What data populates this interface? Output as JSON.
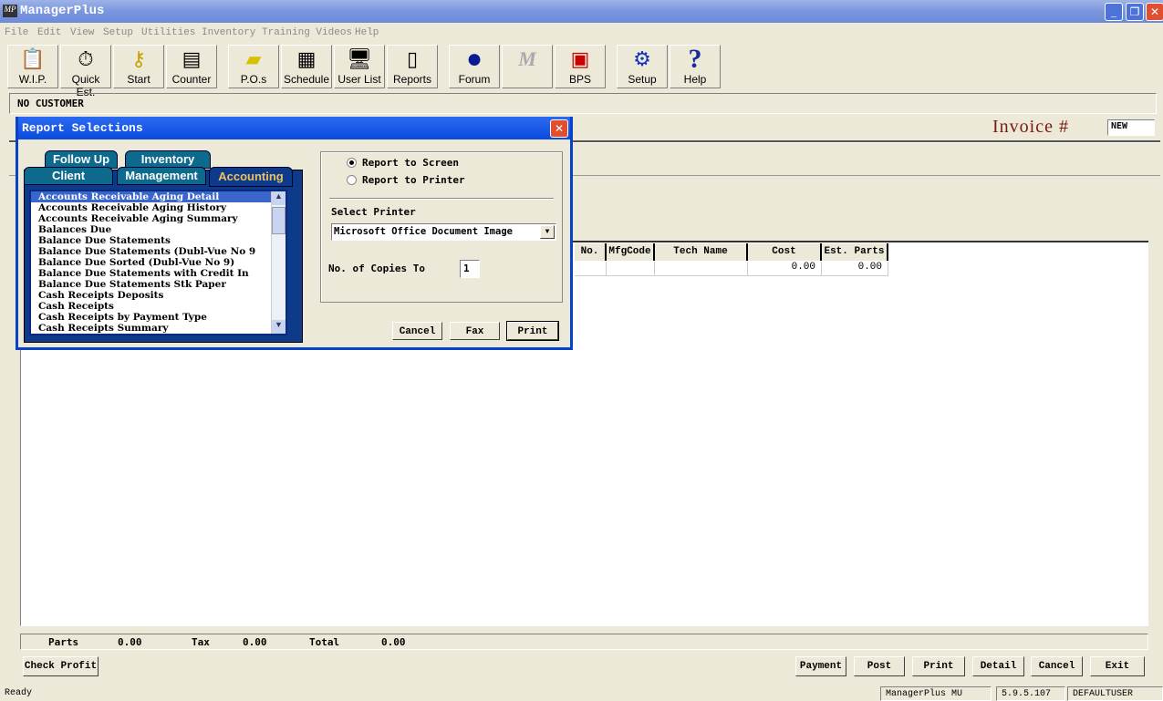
{
  "app": {
    "title": "ManagerPlus",
    "logo": "MP"
  },
  "menu": [
    "File",
    "Edit",
    "View",
    "Setup",
    "Utilities",
    "Inventory",
    "Training Videos",
    "Help"
  ],
  "toolbar": [
    {
      "label": "W.I.P.",
      "icon": "clipboard-icon"
    },
    {
      "label": "Quick Est.",
      "icon": "stopwatch-icon"
    },
    {
      "label": "Start",
      "icon": "key-icon"
    },
    {
      "label": "Counter",
      "icon": "register-icon"
    },
    {
      "label": "P.O.s",
      "icon": "purchase-order-icon"
    },
    {
      "label": "Schedule",
      "icon": "calendar-icon"
    },
    {
      "label": "User List",
      "icon": "computer-icon"
    },
    {
      "label": "Reports",
      "icon": "reports-icon"
    },
    {
      "label": "Forum",
      "icon": "globe-icon"
    },
    {
      "label": "",
      "icon": "m-logo-icon"
    },
    {
      "label": "BPS",
      "icon": "envelope-icon"
    },
    {
      "label": "Setup",
      "icon": "gears-icon"
    },
    {
      "label": "Help",
      "icon": "question-icon"
    }
  ],
  "customer": "NO CUSTOMER",
  "invoice": {
    "label": "Invoice #",
    "value": "NEW"
  },
  "grid": {
    "columns": [
      "No.",
      "MfgCode",
      "Tech Name",
      "Cost",
      "Est. Parts"
    ],
    "row": [
      "",
      "",
      "",
      "0.00",
      "0.00"
    ]
  },
  "totals": {
    "parts_label": "Parts",
    "parts": "0.00",
    "tax_label": "Tax",
    "tax": "0.00",
    "total_label": "Total",
    "total": "0.00"
  },
  "buttons": {
    "check_profit": "Check Profit",
    "payment": "Payment",
    "post": "Post",
    "print": "Print",
    "detail": "Detail",
    "cancel": "Cancel",
    "exit": "Exit"
  },
  "status": {
    "ready": "Ready",
    "product": "ManagerPlus MU",
    "version": "5.9.5.107",
    "user": "DEFAULTUSER"
  },
  "dialog": {
    "title": "Report Selections",
    "tabs": [
      "Follow Up",
      "Inventory",
      "Client",
      "Management",
      "Accounting"
    ],
    "active_tab": "Accounting",
    "reports": [
      "Accounts Receivable Aging Detail",
      "Accounts Receivable Aging History",
      "Accounts Receivable Aging Summary",
      "Balances Due",
      "Balance Due Statements",
      "Balance Due Statements (Dubl-Vue No 9",
      "Balance Due Sorted (Dubl-Vue No 9)",
      "Balance Due Statements with Credit In",
      "Balance Due Statements Stk Paper",
      "Cash Receipts Deposits",
      "Cash Receipts",
      "Cash Receipts by Payment Type",
      "Cash Receipts Summary"
    ],
    "selected_report": "Accounts Receivable Aging Detail",
    "report_to_screen": "Report to Screen",
    "report_to_printer": "Report to Printer",
    "output": "screen",
    "select_printer_label": "Select Printer",
    "printer": "Microsoft Office Document Image",
    "copies_label": "No. of Copies To",
    "copies": "1",
    "cancel": "Cancel",
    "fax": "Fax",
    "print": "Print"
  }
}
